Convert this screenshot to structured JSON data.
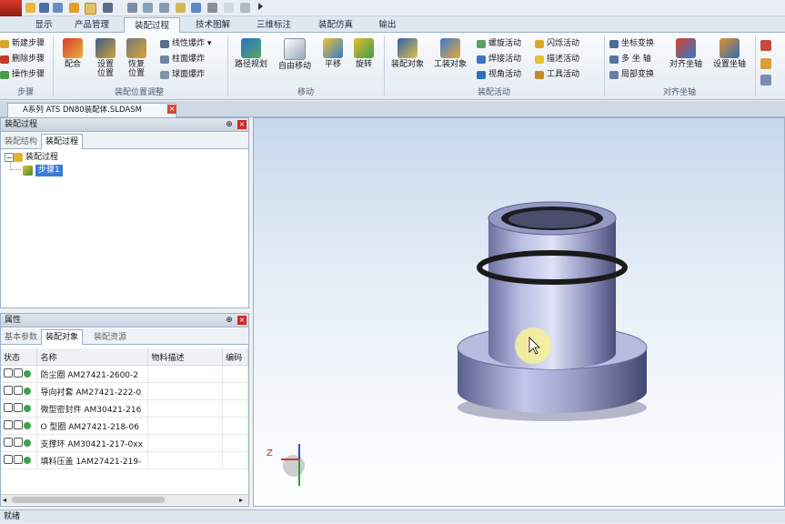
{
  "tabs": [
    {
      "label": "显示",
      "active": false
    },
    {
      "label": "产品管理",
      "active": false
    },
    {
      "label": "装配过程",
      "active": true
    },
    {
      "label": "技术图解",
      "active": false
    },
    {
      "label": "三维标注",
      "active": false
    },
    {
      "label": "装配仿真",
      "active": false
    },
    {
      "label": "输出",
      "active": false
    }
  ],
  "ribbon": {
    "steps": {
      "new_step": "新建步骤",
      "delete_step": "删除步骤",
      "action_step": "操作步骤",
      "group": "步骤"
    },
    "position": {
      "fit": "配合",
      "set_pos_1": "设置",
      "set_pos_2": "位置",
      "restore_pos_1": "恢复",
      "restore_pos_2": "位置",
      "linear_explode": "线性爆炸",
      "cyl_explode": "柱面爆炸",
      "sph_explode": "球面爆炸",
      "group": "装配位置调整"
    },
    "move": {
      "path_plan": "路径规划",
      "free_move": "自由移动",
      "translate": "平移",
      "rotate": "旋转",
      "group": "移动"
    },
    "activity": {
      "assembly_object": "装配对象",
      "tool_object": "工装对象",
      "screw": "螺旋活动",
      "weld": "焊接活动",
      "view": "视角活动",
      "flash": "闪烁活动",
      "desc": "描述活动",
      "tool": "工具活动",
      "group": "装配活动"
    },
    "axis": {
      "axis_change": "坐标变换",
      "multi_axis": "多 坐 轴",
      "local_change": "局部变换",
      "align_axis": "对齐坐轴",
      "set_axis": "设置坐轴",
      "group": "对齐坐轴"
    }
  },
  "document": {
    "tab_title": "A系列 ATS DN80装配体.SLDASM"
  },
  "panel_top": {
    "title": "装配过程",
    "tabs": [
      {
        "label": "装配结构",
        "active": false
      },
      {
        "label": "装配过程",
        "active": true
      }
    ],
    "tree_root": "装配过程",
    "tree_child": "步骤1"
  },
  "panel_bottom": {
    "title": "属性",
    "tabs": [
      {
        "label": "基本参数",
        "active": false
      },
      {
        "label": "装配对象",
        "active": true
      },
      {
        "label": "装配资源",
        "active": false
      }
    ],
    "columns": [
      "状态",
      "名称",
      "物料描述",
      "编码"
    ],
    "rows": [
      {
        "name": "防尘圈  AM27421-2600-2"
      },
      {
        "name": "导向衬套 AM27421-222-0"
      },
      {
        "name": "微型密封件 AM30421-216"
      },
      {
        "name": "O 型圈 AM27421-218-06"
      },
      {
        "name": "支撑环 AM30421-217-0xx"
      },
      {
        "name": "填料压盖 1AM27421-219-"
      }
    ]
  },
  "viewport": {
    "axis_z": "Z"
  },
  "status": {
    "text": "就绪"
  }
}
